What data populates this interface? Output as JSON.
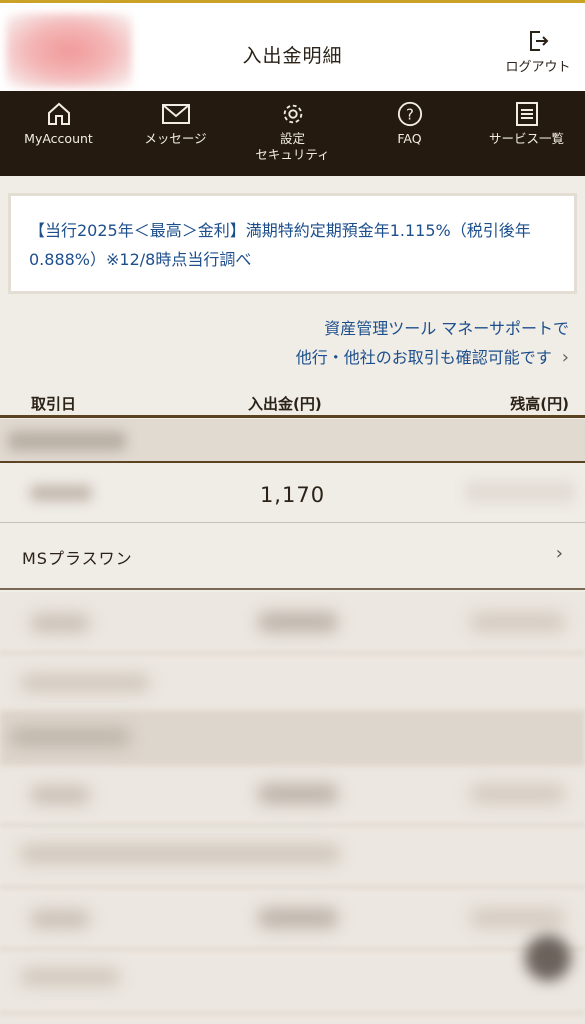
{
  "header": {
    "title": "入出金明細",
    "logout_label": "ログアウト"
  },
  "nav": {
    "items": [
      {
        "label": "MyAccount",
        "icon": "home-icon"
      },
      {
        "label": "メッセージ",
        "icon": "mail-icon"
      },
      {
        "label": "設定\nセキュリティ",
        "icon": "gear-icon"
      },
      {
        "label": "FAQ",
        "icon": "question-icon"
      },
      {
        "label": "サービス一覧",
        "icon": "list-icon"
      }
    ]
  },
  "notice": {
    "text": "【当行2025年＜最高＞金利】満期特約定期預金年1.115%（税引後年0.888%）※12/8時点当行調べ"
  },
  "promo": {
    "line1": "資産管理ツール マネーサポートで",
    "line2": "他行・他社のお取引も確認可能です"
  },
  "table": {
    "headers": {
      "date": "取引日",
      "amount": "入出金(円)",
      "balance": "残高(円)"
    },
    "rows": [
      {
        "amount": "1,170",
        "description": "MSプラスワン"
      }
    ]
  },
  "colors": {
    "accent_gold": "#c9a227",
    "nav_bg": "#241a0f",
    "link_blue": "#1d4f8c",
    "page_bg": "#f0ece6"
  }
}
